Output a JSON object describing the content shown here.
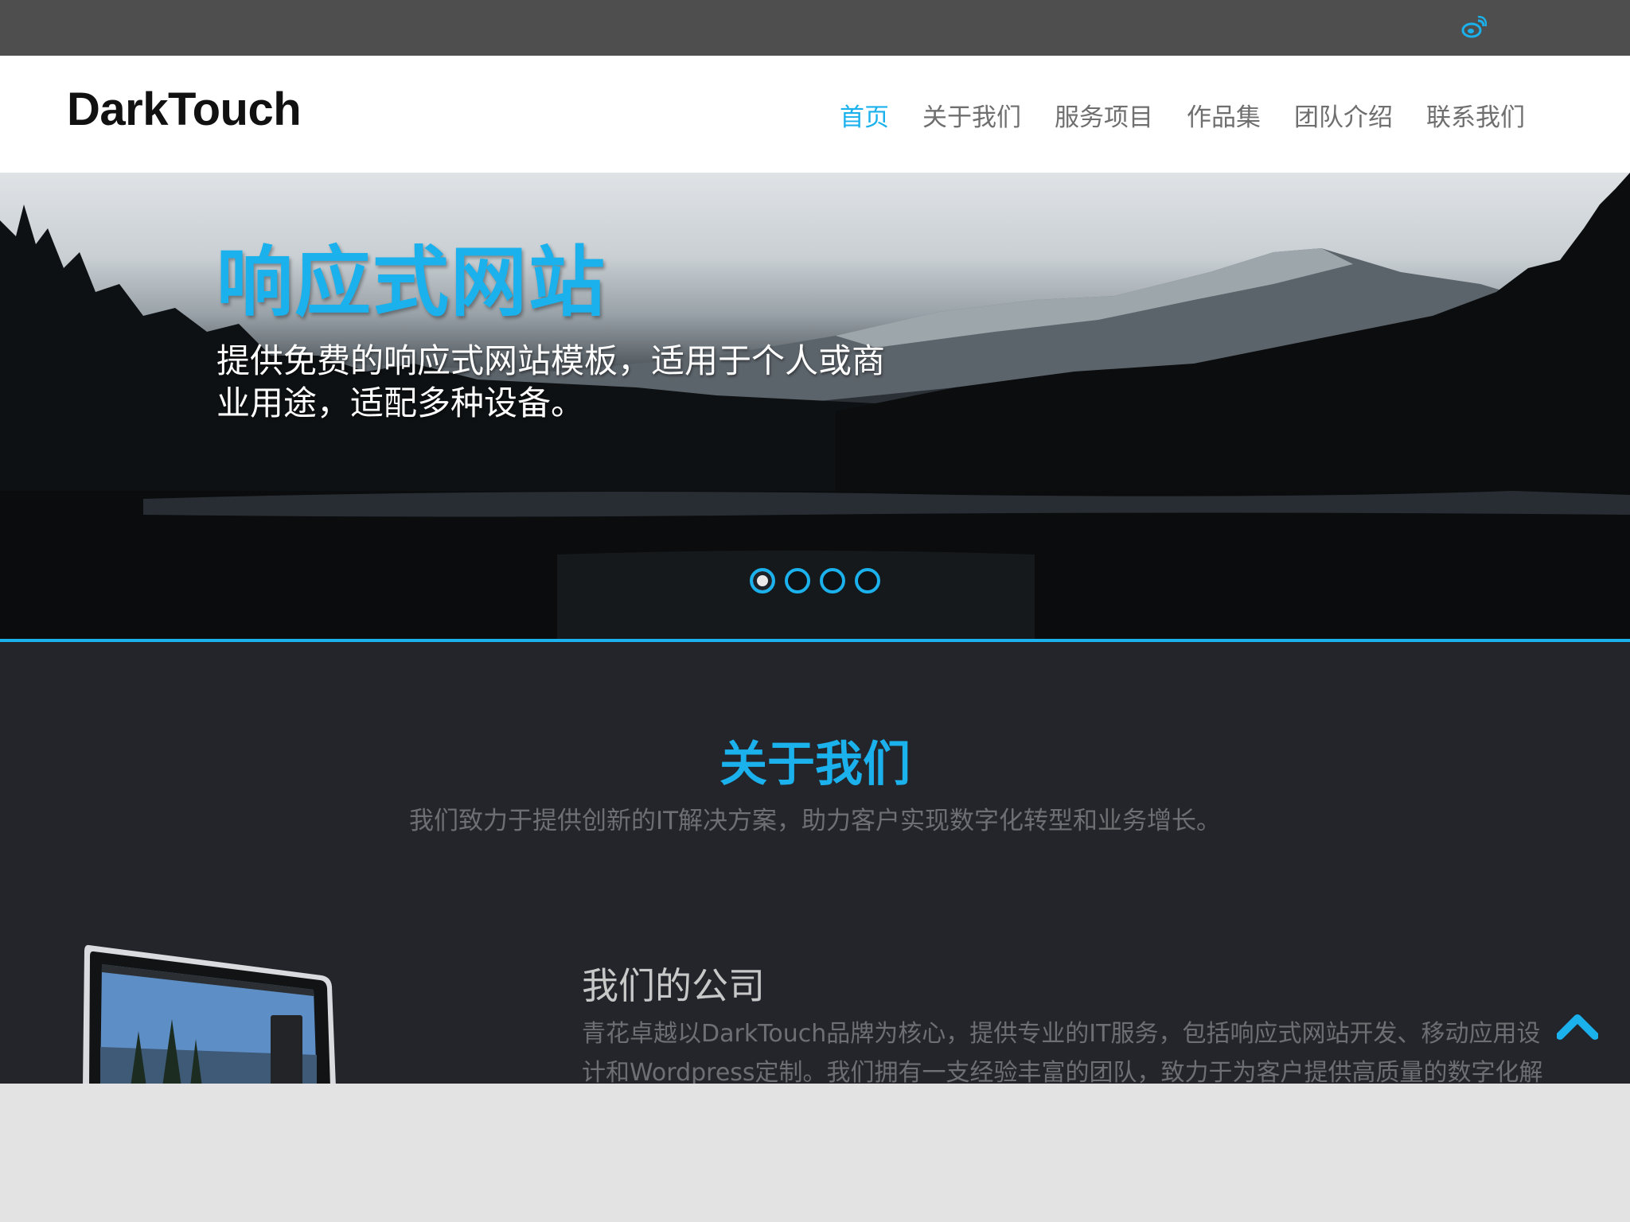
{
  "topbar": {
    "social_icon": "weibo-icon"
  },
  "header": {
    "logo": "DarkTouch",
    "nav": [
      {
        "label": "首页",
        "active": true
      },
      {
        "label": "关于我们",
        "active": false
      },
      {
        "label": "服务项目",
        "active": false
      },
      {
        "label": "作品集",
        "active": false
      },
      {
        "label": "团队介绍",
        "active": false
      },
      {
        "label": "联系我们",
        "active": false
      }
    ]
  },
  "hero": {
    "title": "响应式网站",
    "description": "提供免费的响应式网站模板，适用于个人或商业用途，适配多种设备。",
    "slides_count": 4,
    "active_slide": 1
  },
  "about": {
    "title": "关于我们",
    "subtitle": "我们致力于提供创新的IT解决方案，助力客户实现数字化转型和业务增长。",
    "company_title": "我们的公司",
    "company_text": "青花卓越以DarkTouch品牌为核心，提供专业的IT服务，包括响应式网站开发、移动应用设计和Wordpress定制。我们拥有一支经验丰富的团队，致力于为客户提供高质量的数字化解"
  },
  "colors": {
    "accent": "#1ab1ec",
    "topbar": "#4e4e4e",
    "dark_bg": "#23252b"
  },
  "back_to_top_icon": "chevron-up-icon"
}
